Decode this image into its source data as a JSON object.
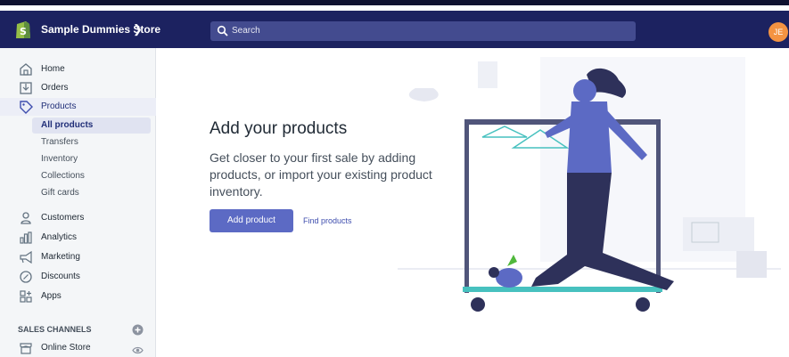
{
  "topbar": {
    "store_name": "Sample Dummies Store",
    "store_dropdown_icon": "chevron-down-icon",
    "search_placeholder": "Search",
    "avatar_initials": "JE",
    "colors": {
      "bar": "#1c2260",
      "search": "#434b8f",
      "avatar": "#f49342"
    }
  },
  "sidebar": {
    "items": [
      {
        "label": "Home",
        "icon": "home-icon"
      },
      {
        "label": "Orders",
        "icon": "orders-icon"
      },
      {
        "label": "Products",
        "icon": "tag-icon"
      }
    ],
    "product_subitems": [
      {
        "label": "All products"
      },
      {
        "label": "Transfers"
      },
      {
        "label": "Inventory"
      },
      {
        "label": "Collections"
      },
      {
        "label": "Gift cards"
      }
    ],
    "more_items": [
      {
        "label": "Customers",
        "icon": "customers-icon"
      },
      {
        "label": "Analytics",
        "icon": "analytics-icon"
      },
      {
        "label": "Marketing",
        "icon": "megaphone-icon"
      },
      {
        "label": "Discounts",
        "icon": "discount-icon"
      },
      {
        "label": "Apps",
        "icon": "apps-icon"
      }
    ],
    "channels_title": "SALES CHANNELS",
    "channels": [
      {
        "label": "Online Store",
        "icon": "store-icon"
      }
    ]
  },
  "main": {
    "heading": "Add your products",
    "description": "Get closer to your first sale by adding products, or import your existing product inventory.",
    "primary_button": "Add product",
    "secondary_link": "Find products",
    "colors": {
      "primary": "#5c6ac4",
      "link": "#3f4eae"
    }
  }
}
